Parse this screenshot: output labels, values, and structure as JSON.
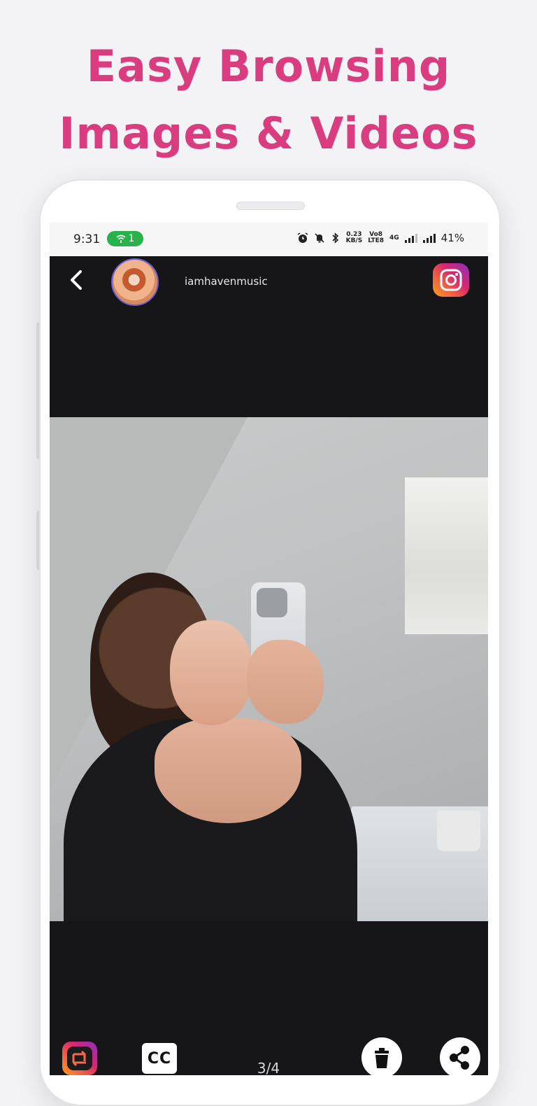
{
  "headline": {
    "line1": "Easy Browsing",
    "line2": "Images  & Videos"
  },
  "statusbar": {
    "time": "9:31",
    "hotspot_count": "1",
    "net_speed_top": "0.23",
    "net_speed_bottom": "KB/S",
    "volte_top": "Vo8",
    "volte_bottom": "LTE8",
    "network": "4G",
    "battery": "41%"
  },
  "appbar": {
    "username": "iamhavenmusic"
  },
  "viewer": {
    "counter": "3/4"
  },
  "bottombar": {
    "cc_label": "CC"
  },
  "colors": {
    "accent": "#d93c7f",
    "screen_bg": "#161618",
    "hotspot": "#27b24a"
  }
}
